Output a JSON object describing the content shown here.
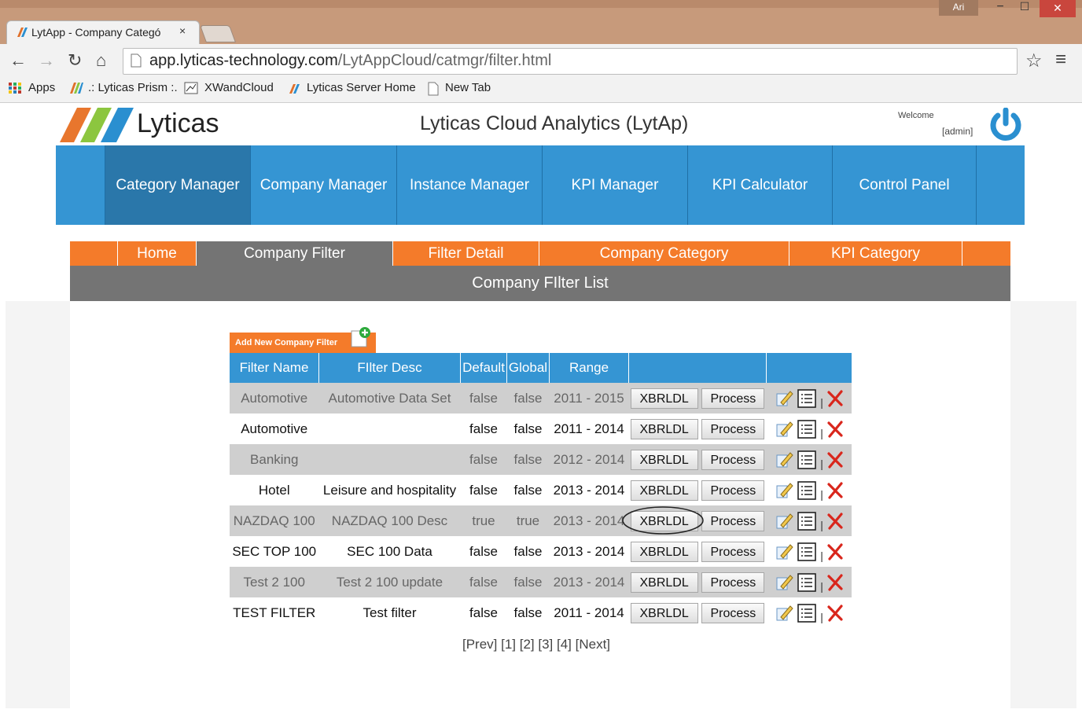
{
  "browser": {
    "tab_title": "LytApp - Company Categó",
    "tab_close": "×",
    "window_user": "Ari",
    "url_host": "app.lyticas-technology.com",
    "url_path": "/LytAppCloud/catmgr/filter.html",
    "bookmarks": [
      {
        "label": "Apps"
      },
      {
        "label": ".: Lyticas Prism :."
      },
      {
        "label": "XWandCloud"
      },
      {
        "label": "Lyticas Server Home"
      },
      {
        "label": "New Tab"
      }
    ]
  },
  "header": {
    "logo_text": "Lyticas",
    "app_title": "Lyticas Cloud Analytics (LytAp)",
    "welcome": "Welcome",
    "user": "[admin]"
  },
  "main_nav": [
    {
      "label": "Category Manager",
      "active": true
    },
    {
      "label": "Company Manager"
    },
    {
      "label": "Instance Manager"
    },
    {
      "label": "KPI Manager"
    },
    {
      "label": "KPI Calculator"
    },
    {
      "label": "Control Panel"
    }
  ],
  "sub_nav": [
    {
      "label": "Home"
    },
    {
      "label": "Company Filter",
      "active": true
    },
    {
      "label": "Filter Detail"
    },
    {
      "label": "Company Category"
    },
    {
      "label": "KPI Category"
    }
  ],
  "list_title": "Company FIlter List",
  "add_button": "Add New Company Filter",
  "table": {
    "headers": [
      "Filter Name",
      "FIlter Desc",
      "Default",
      "Global",
      "Range"
    ],
    "xbrl_label": "XBRLDL",
    "process_label": "Process",
    "separator": "|",
    "rows": [
      {
        "name": "Automotive",
        "desc": "Automotive Data Set",
        "default": "false",
        "global": "false",
        "range": "2011 - 2015"
      },
      {
        "name": "Automotive",
        "desc": "",
        "default": "false",
        "global": "false",
        "range": "2011 - 2014"
      },
      {
        "name": "Banking",
        "desc": "",
        "default": "false",
        "global": "false",
        "range": "2012 - 2014"
      },
      {
        "name": "Hotel",
        "desc": "Leisure and hospitality",
        "default": "false",
        "global": "false",
        "range": "2013 - 2014"
      },
      {
        "name": "NAZDAQ 100",
        "desc": "NAZDAQ 100 Desc",
        "default": "true",
        "global": "true",
        "range": "2013 - 2014"
      },
      {
        "name": "SEC TOP 100",
        "desc": "SEC 100 Data",
        "default": "false",
        "global": "false",
        "range": "2013 - 2014"
      },
      {
        "name": "Test 2 100",
        "desc": "Test 2 100 update",
        "default": "false",
        "global": "false",
        "range": "2013 - 2014"
      },
      {
        "name": "TEST FILTER",
        "desc": "Test filter",
        "default": "false",
        "global": "false",
        "range": "2011 - 2014"
      }
    ]
  },
  "pager": "[Prev] [1] [2] [3] [4] [Next]",
  "colors": {
    "nav_blue": "#3595d3",
    "nav_active": "#2a77aa",
    "orange": "#f47b2a",
    "gray_bar": "#747474",
    "delete_red": "#d9261c"
  }
}
